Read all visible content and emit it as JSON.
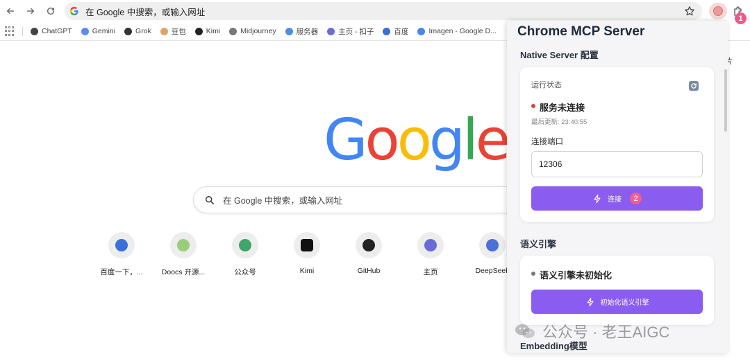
{
  "toolbar": {
    "omnibox_text": "在 Google 中搜索，或输入网址",
    "step_badge": "1"
  },
  "bookmarks": [
    {
      "label": "ChatGPT",
      "icon": "chatgpt-icon",
      "color": "#444444"
    },
    {
      "label": "Gemini",
      "icon": "gemini-icon",
      "color": "#5b8def"
    },
    {
      "label": "Grok",
      "icon": "grok-icon",
      "color": "#333333"
    },
    {
      "label": "豆包",
      "icon": "doubao-icon",
      "color": "#e0a16b"
    },
    {
      "label": "Kimi",
      "icon": "kimi-icon",
      "color": "#222222"
    },
    {
      "label": "Midjourney",
      "icon": "midjourney-icon",
      "color": "#777777"
    },
    {
      "label": "服务器",
      "icon": "cloud-icon",
      "color": "#4d8fe0"
    },
    {
      "label": "主页 - 扣子",
      "icon": "coze-icon",
      "color": "#6b6bd6"
    },
    {
      "label": "百度",
      "icon": "baidu-icon",
      "color": "#3b6fd8"
    },
    {
      "label": "Imagen - Google D...",
      "icon": "imagen-icon",
      "color": "#4a86e8"
    }
  ],
  "ntp": {
    "logo_letters": [
      {
        "ch": "G",
        "color": "#4285F4"
      },
      {
        "ch": "o",
        "color": "#EA4335"
      },
      {
        "ch": "o",
        "color": "#FBBC05"
      },
      {
        "ch": "g",
        "color": "#4285F4"
      },
      {
        "ch": "l",
        "color": "#34A853"
      },
      {
        "ch": "e",
        "color": "#EA4335"
      }
    ],
    "search_placeholder": "在 Google 中搜索，或输入网址",
    "shortcuts": [
      {
        "label": "百度一下，...",
        "icon": "baidu-icon"
      },
      {
        "label": "Doocs 开源...",
        "icon": "doocs-icon"
      },
      {
        "label": "公众号",
        "icon": "wechat-mp-icon"
      },
      {
        "label": "Kimi",
        "icon": "kimi-icon"
      },
      {
        "label": "GitHub",
        "icon": "github-icon"
      },
      {
        "label": "主页",
        "icon": "coze-icon"
      },
      {
        "label": "DeepSeek",
        "icon": "deepseek-icon"
      }
    ],
    "right_fragment": "片"
  },
  "panel": {
    "title": "Chrome MCP Server",
    "native_section_title": "Native Server 配置",
    "status_label": "运行状态",
    "status_text": "服务未连接",
    "status_color": "#e0413f",
    "last_updated": "最后更新: 23:40:55",
    "port_label": "连接端口",
    "port_value": "12306",
    "connect_label": "连接",
    "connect_badge": "2",
    "semantic_section_title": "语义引擎",
    "semantic_status": "语义引擎未初始化",
    "semantic_status_color": "#777777",
    "init_label": "初始化语义引擎",
    "embedding_section_title": "Embedding模型",
    "accent_color": "#8a5cf0"
  },
  "watermark": {
    "text": "公众号 · 老王AIGC"
  }
}
